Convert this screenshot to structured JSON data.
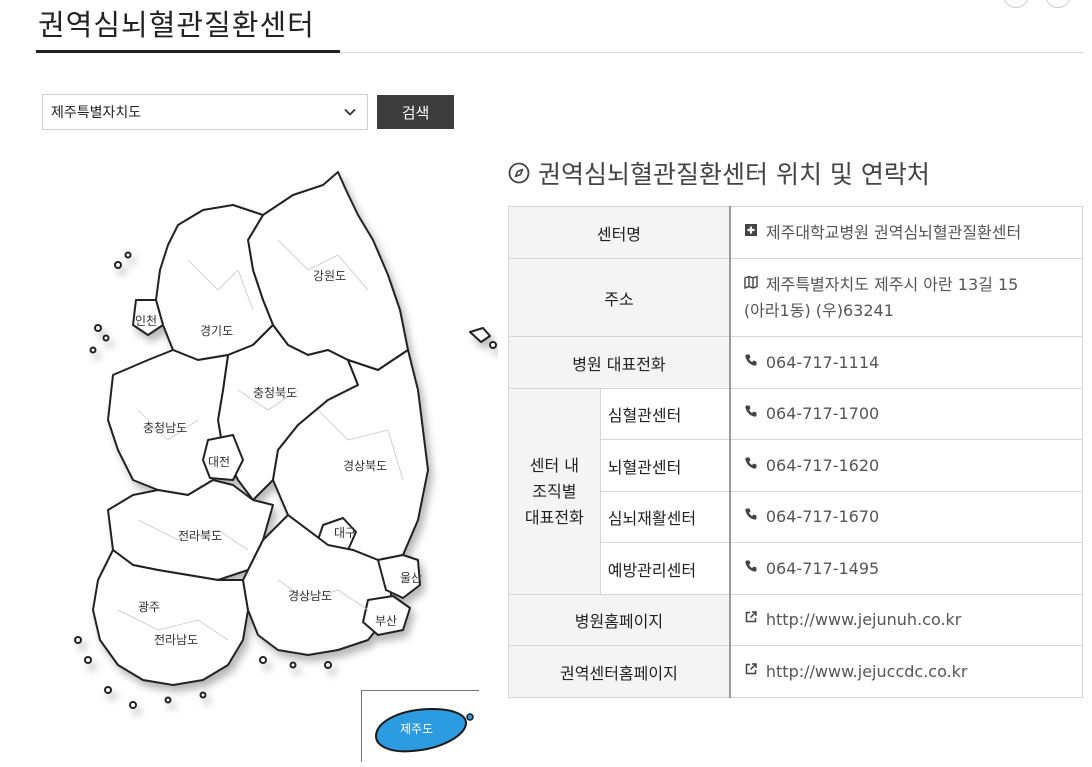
{
  "header": {
    "title": "권역심뇌혈관질환센터"
  },
  "search": {
    "selected_region": "제주특별자치도",
    "button_label": "검색"
  },
  "map": {
    "regions": [
      "강원도",
      "경기도",
      "인천",
      "충청북도",
      "충청남도",
      "대전",
      "경상북도",
      "대구",
      "전라북도",
      "광주",
      "전라남도",
      "경상남도",
      "울산",
      "부산",
      "제주도"
    ],
    "highlighted_region": "제주도",
    "highlight_color": "#2d9be0"
  },
  "section": {
    "title": "권역심뇌혈관질환센터 위치 및 연락처"
  },
  "info_table": {
    "center_name_label": "센터명",
    "center_name": "제주대학교병원 권역심뇌혈관질환센터",
    "address_label": "주소",
    "address_line1": "제주특별자치도 제주시 아란 13길 15",
    "address_line2": "(아라1동) (우)63241",
    "main_phone_label": "병원 대표전화",
    "main_phone": "064-717-1114",
    "dept_group_label_1": "센터 내",
    "dept_group_label_2": "조직별",
    "dept_group_label_3": "대표전화",
    "departments": [
      {
        "name": "심혈관센터",
        "phone": "064-717-1700"
      },
      {
        "name": "뇌혈관센터",
        "phone": "064-717-1620"
      },
      {
        "name": "심뇌재활센터",
        "phone": "064-717-1670"
      },
      {
        "name": "예방관리센터",
        "phone": "064-717-1495"
      }
    ],
    "hospital_homepage_label": "병원홈페이지",
    "hospital_homepage": "http://www.jejunuh.co.kr",
    "center_homepage_label": "권역센터홈페이지",
    "center_homepage": "http://www.jejuccdc.co.kr"
  }
}
